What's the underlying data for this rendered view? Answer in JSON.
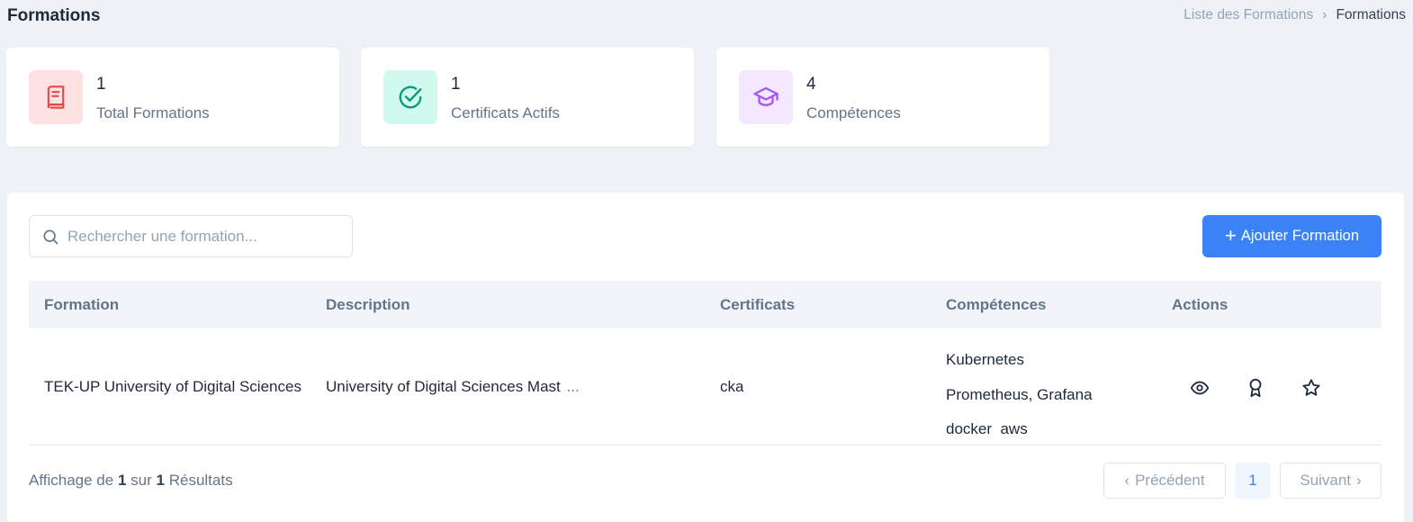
{
  "header": {
    "title": "Formations",
    "breadcrumb": [
      "Liste des Formations",
      "Formations"
    ]
  },
  "stats": [
    {
      "value": "1",
      "label": "Total Formations",
      "icon": "book-icon",
      "color": "#ef4444",
      "bg": "#fee2e2"
    },
    {
      "value": "1",
      "label": "Certificats Actifs",
      "icon": "check-circle-icon",
      "color": "#0f9a79",
      "bg": "#d1faef"
    },
    {
      "value": "4",
      "label": "Compétences",
      "icon": "graduation-cap-icon",
      "color": "#a855f7",
      "bg": "#f3e8ff"
    }
  ],
  "search": {
    "placeholder": "Rechercher une formation..."
  },
  "add_button": {
    "label": "Ajouter Formation"
  },
  "table": {
    "columns": [
      "Formation",
      "Description",
      "Certificats",
      "Compétences",
      "Actions"
    ],
    "rows": [
      {
        "formation": "TEK-UP University of Digital Sciences",
        "description": "University of Digital Sciences Mast",
        "description_more": "...",
        "certificats": "cka",
        "competences": [
          "Kubernetes",
          "Prometheus, Grafana",
          "docker  aws"
        ]
      }
    ],
    "actions": [
      "eye-icon",
      "award-icon",
      "star-icon"
    ]
  },
  "footer": {
    "prefix": "Affichage de",
    "from": "1",
    "middle": "sur",
    "total": "1",
    "suffix": "Résultats",
    "prev_label": "Précédent",
    "page": "1",
    "next_label": "Suivant"
  },
  "colors": {
    "accent": "#3b82f6",
    "background": "#eef2f7"
  }
}
